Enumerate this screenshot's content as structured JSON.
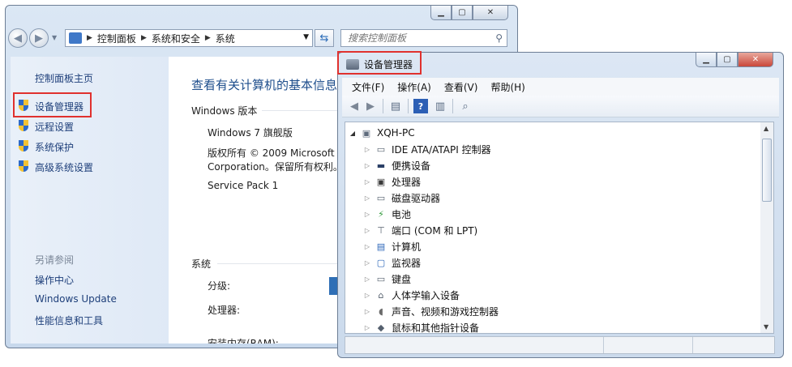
{
  "control_panel": {
    "address": [
      "控制面板",
      "系统和安全",
      "系统"
    ],
    "search_placeholder": "搜索控制面板",
    "sidebar": {
      "home": "控制面板主页",
      "links": [
        "设备管理器",
        "远程设置",
        "系统保护",
        "高级系统设置"
      ],
      "see_also_header": "另请参阅",
      "see_also": [
        "操作中心",
        "Windows Update",
        "性能信息和工具"
      ]
    },
    "main": {
      "heading": "查看有关计算机的基本信息",
      "edition_header": "Windows 版本",
      "edition_name": "Windows 7 旗舰版",
      "copyright_line1": "版权所有 © 2009 Microsoft",
      "copyright_line2": "Corporation。保留所有权利。",
      "service_pack": "Service Pack 1",
      "system_header": "系统",
      "rating_label": "分级:",
      "processor_label": "处理器:",
      "ram_label": "安装内存(RAM):"
    }
  },
  "device_manager": {
    "title": "设备管理器",
    "menu": [
      "文件(F)",
      "操作(A)",
      "查看(V)",
      "帮助(H)"
    ],
    "root": "XQH-PC",
    "devices": [
      {
        "label": "IDE ATA/ATAPI 控制器",
        "icon": "ide-controller-icon"
      },
      {
        "label": "便携设备",
        "icon": "portable-device-icon"
      },
      {
        "label": "处理器",
        "icon": "processor-icon"
      },
      {
        "label": "磁盘驱动器",
        "icon": "disk-drive-icon"
      },
      {
        "label": "电池",
        "icon": "battery-icon"
      },
      {
        "label": "端口 (COM 和 LPT)",
        "icon": "port-icon"
      },
      {
        "label": "计算机",
        "icon": "computer-icon"
      },
      {
        "label": "监视器",
        "icon": "monitor-icon"
      },
      {
        "label": "键盘",
        "icon": "keyboard-icon"
      },
      {
        "label": "人体学输入设备",
        "icon": "hid-icon"
      },
      {
        "label": "声音、视频和游戏控制器",
        "icon": "sound-icon"
      },
      {
        "label": "鼠标和其他指针设备",
        "icon": "mouse-icon"
      }
    ]
  },
  "highlight_color": "#e0312e"
}
